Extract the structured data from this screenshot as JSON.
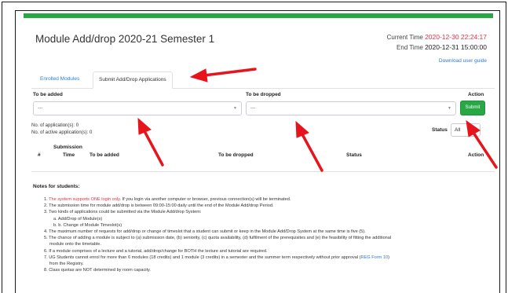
{
  "page": {
    "title": "Module Add/drop 2020-21 Semester 1",
    "current_time_label": "Current Time",
    "current_time": "2020-12-30 22:24:17",
    "end_time_label": "End Time",
    "end_time": "2020-12-31 15:00:00",
    "download_guide": "Download user guide"
  },
  "tabs": [
    {
      "label": "Enrolled Modules",
      "active": false
    },
    {
      "label": "Submit Add/Drop Applications",
      "active": true
    }
  ],
  "form": {
    "to_be_added_label": "To be added",
    "to_be_dropped_label": "To be dropped",
    "action_label": "Action",
    "add_select_value": "---",
    "drop_select_value": "---",
    "submit_label": "Submit"
  },
  "summary": {
    "applications": "No. of application(s): 0",
    "active_applications": "No. of active application(s): 0",
    "status_label": "Status",
    "status_value": "All"
  },
  "table": {
    "headers": {
      "num": "#",
      "submission": "Submission",
      "time": "Time",
      "to_be_added": "To be added",
      "to_be_dropped": "To be dropped",
      "status": "Status",
      "action": "Action"
    }
  },
  "notes": {
    "title": "Notes for students:",
    "n1_red": "The system supports ONE login only.",
    "n1_rest": " If you login via another computer or browser, previous connection(s) will be terminated.",
    "n2": "The submission time for module add/drop is between 09:00-15:00 daily until the end of the Module Add/drop Period.",
    "n3": "Two kinds of applications could be submitted via the Module Add/drop System:",
    "n3a": "a. Add/Drop of Module(s)",
    "n3b": "b. b. Change of Module Timeslot(s)",
    "n4": "The maximum number of requests for add/drop or change of timeslot that a student can submit or keep in the Module Add/Drop System at the same time is five (5).",
    "n5": "The chance of adding a module is subject to (a) submission date, (b) seniority, (c) quota availability, (d) fulfilment of the prerequisites and (e) the feasibility of fitting the additional",
    "n5_cont": "module onto the timetable.",
    "n6": "If a module comprises of a lecture and a tutorial, add/drop/change for BOTH the lecture and tutorial are required.",
    "n7": "UG Students cannot enrol for more than 6 modules (18 credits) and 1 module (3 credits) in a semester and the summer term respectively without prior approval (",
    "n7_link": "REG Form 10",
    "n7_end": ")",
    "n7_cont": "from the Registry.",
    "n8": "Class quotas are NOT determined by room capacity."
  },
  "colors": {
    "green": "#28a745",
    "red": "#dc3545",
    "link": "#2b7bd8",
    "arrow": "#e8141c"
  }
}
